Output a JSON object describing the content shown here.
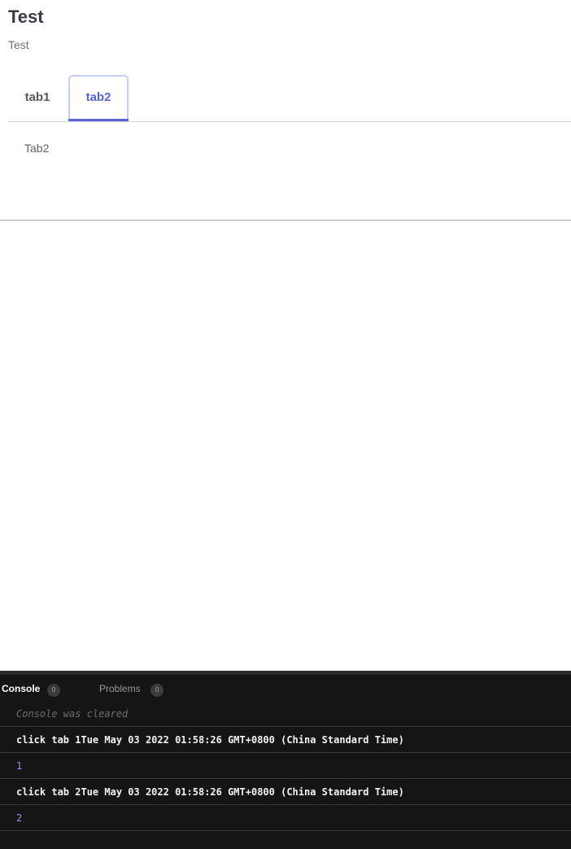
{
  "header": {
    "title": "Test",
    "subtitle": "Test"
  },
  "tabs": [
    {
      "label": "tab1",
      "active": false
    },
    {
      "label": "tab2",
      "active": true
    }
  ],
  "panel": {
    "content": "Tab2"
  },
  "console": {
    "tabs": [
      {
        "label": "Console",
        "count": "0",
        "active": true
      },
      {
        "label": "Problems",
        "count": "0",
        "active": false
      }
    ],
    "cleared_message": "Console was cleared",
    "lines": [
      {
        "text": "click tab 1Tue May 03 2022 01:58:26 GMT+0800 (China Standard Time)",
        "kind": "log"
      },
      {
        "text": "1",
        "kind": "number"
      },
      {
        "text": "click tab 2Tue May 03 2022 01:58:26 GMT+0800 (China Standard Time)",
        "kind": "log"
      },
      {
        "text": "2",
        "kind": "number"
      }
    ]
  },
  "colors": {
    "accent": "#5a62d6",
    "console_bg": "#151515",
    "number": "#9d8cff"
  }
}
